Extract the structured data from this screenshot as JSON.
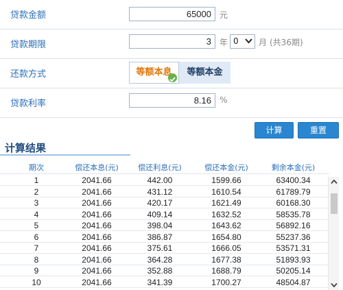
{
  "form": {
    "amount": {
      "label": "贷款金额",
      "value": "65000",
      "unit": "元"
    },
    "term": {
      "label": "贷款期限",
      "years": "3",
      "year_unit": "年",
      "months": "0",
      "month_unit": "月",
      "total": "(共36期)"
    },
    "method": {
      "label": "还款方式",
      "options": [
        "等额本息",
        "等额本金"
      ],
      "selected": "等额本息"
    },
    "rate": {
      "label": "贷款利率",
      "value": "8.16",
      "unit": "%"
    }
  },
  "buttons": {
    "calculate": "计算",
    "reset": "重置"
  },
  "results": {
    "title": "计算结果",
    "columns": [
      "期次",
      "偿还本息(元)",
      "偿还利息(元)",
      "偿还本金(元)",
      "剩余本金(元)"
    ],
    "rows": [
      [
        "1",
        "2041.66",
        "442.00",
        "1599.66",
        "63400.34"
      ],
      [
        "2",
        "2041.66",
        "431.12",
        "1610.54",
        "61789.79"
      ],
      [
        "3",
        "2041.66",
        "420.17",
        "1621.49",
        "60168.30"
      ],
      [
        "4",
        "2041.66",
        "409.14",
        "1632.52",
        "58535.78"
      ],
      [
        "5",
        "2041.66",
        "398.04",
        "1643.62",
        "56892.16"
      ],
      [
        "6",
        "2041.66",
        "386.87",
        "1654.80",
        "55237.36"
      ],
      [
        "7",
        "2041.66",
        "375.61",
        "1666.05",
        "53571.31"
      ],
      [
        "8",
        "2041.66",
        "364.28",
        "1677.38",
        "51893.93"
      ],
      [
        "9",
        "2041.66",
        "352.88",
        "1688.79",
        "50205.14"
      ],
      [
        "10",
        "2041.66",
        "341.39",
        "1700.27",
        "48504.87"
      ]
    ]
  },
  "icons": {
    "select": "chevron-down-icon",
    "selected_mark": "check-icon",
    "scroll_up": "chevron-up-icon",
    "scroll_down": "chevron-down-icon"
  },
  "colors": {
    "label": "#2a6fb8",
    "button": "#2a86d0",
    "selected_option_text": "#e0780a",
    "check": "#65b34c"
  }
}
